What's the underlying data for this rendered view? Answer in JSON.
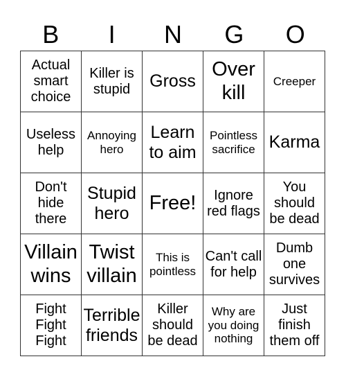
{
  "header": {
    "letters": [
      "B",
      "I",
      "N",
      "G",
      "O"
    ]
  },
  "cells": [
    "Actual smart choice",
    "Killer is stupid",
    "Gross",
    "Over kill",
    "Creeper",
    "Useless help",
    "Annoying hero",
    "Learn to aim",
    "Pointless sacrifice",
    "Karma",
    "Don't hide there",
    "Stupid hero",
    "Free!",
    "Ignore red flags",
    "You should be dead",
    "Villain wins",
    "Twist villain",
    "This is pointless",
    "Can't call for help",
    "Dumb one survives",
    "Fight Fight Fight",
    "Terrible friends",
    "Killer should be dead",
    "Why are you doing nothing",
    "Just finish them off"
  ]
}
